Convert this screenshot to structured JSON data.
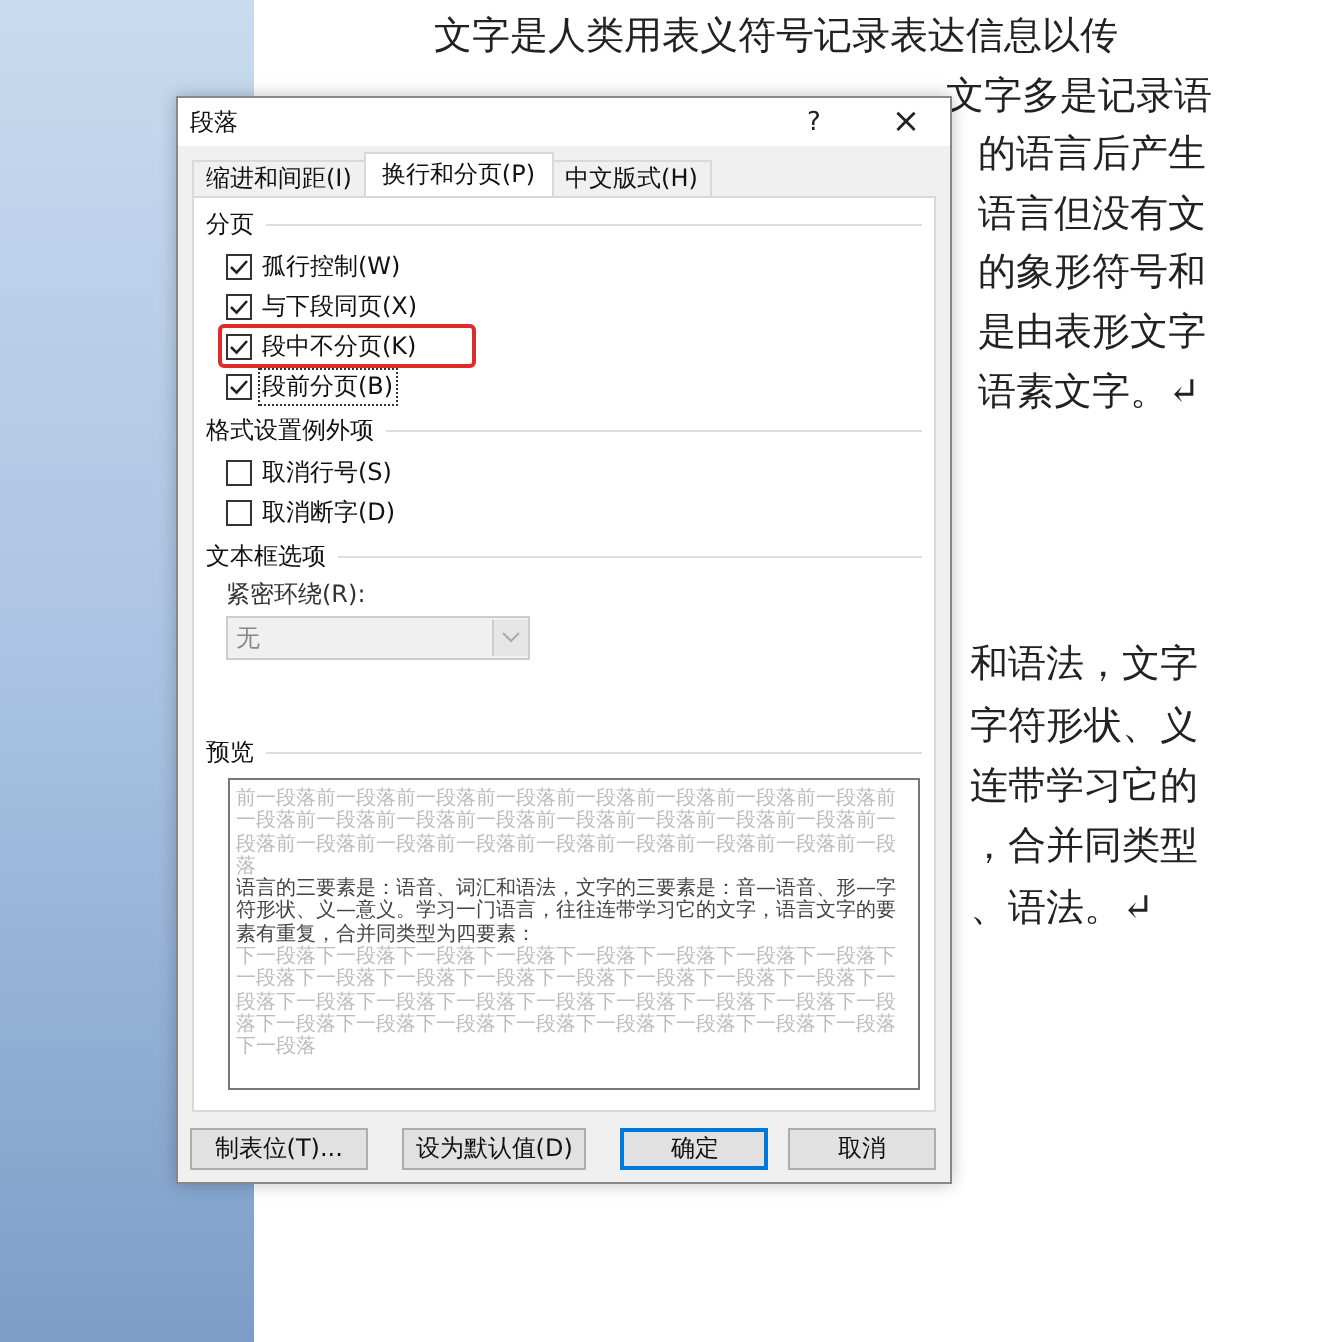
{
  "document": {
    "paragraph_1": [
      {
        "text": "文字是人类用表义符号记录表达信息以传",
        "kind": "full"
      },
      {
        "text": "文字多是记录语",
        "kind": "top"
      },
      {
        "text": "的语言后产生",
        "kind": "cut"
      },
      {
        "text": "语言但没有文",
        "kind": "cut"
      },
      {
        "text": "的象形符号和",
        "kind": "cut"
      },
      {
        "text": "是由表形文字",
        "kind": "cut"
      },
      {
        "text": "语素文字。↵",
        "kind": "cut"
      }
    ],
    "paragraph_2": [
      {
        "text": "和语法，文字",
        "kind": "cut"
      },
      {
        "text": "字符形状、义",
        "kind": "cut"
      },
      {
        "text": "连带学习它的",
        "kind": "cut"
      },
      {
        "text": "，合并同类型",
        "kind": "cut"
      },
      {
        "text": "、语法。↵",
        "kind": "cut"
      }
    ]
  },
  "dialog": {
    "title": "段落",
    "help": "?",
    "close": "×",
    "tabs": [
      {
        "label": "缩进和间距(I)",
        "selected": false
      },
      {
        "label": "换行和分页(P)",
        "selected": true
      },
      {
        "label": "中文版式(H)",
        "selected": false
      }
    ],
    "groups": [
      {
        "title": "分页",
        "items": [
          {
            "label": "孤行控制(W)",
            "checked": true,
            "highlighted": false,
            "focused": false
          },
          {
            "label": "与下段同页(X)",
            "checked": true,
            "highlighted": false,
            "focused": false
          },
          {
            "label": "段中不分页(K)",
            "checked": true,
            "highlighted": true,
            "focused": false
          },
          {
            "label": "段前分页(B)",
            "checked": true,
            "highlighted": false,
            "focused": true
          }
        ]
      },
      {
        "title": "格式设置例外项",
        "items": [
          {
            "label": "取消行号(S)",
            "checked": false,
            "highlighted": false,
            "focused": false
          },
          {
            "label": "取消断字(D)",
            "checked": false,
            "highlighted": false,
            "focused": false
          }
        ]
      }
    ],
    "textbox": {
      "title": "文本框选项",
      "label": "紧密环绕(R):",
      "value": "无",
      "disabled": true
    },
    "preview": {
      "title": "预览",
      "previous_paragraph": "前一段落前一段落前一段落前一段落前一段落前一段落前一段落前一段落前一段落前一段落前一段落前一段落前一段落前一段落前一段落前一段落前一段落前一段落前一段落前一段落前一段落前一段落前一段落前一段落前一段落",
      "sample": "语言的三要素是：语音、词汇和语法，文字的三要素是：音—语音、形—字符形状、义—意义。学习一门语言，往往连带学习它的文字，语言文字的要素有重复，合并同类型为四要素：",
      "next_paragraph": "下一段落下一段落下一段落下一段落下一段落下一段落下一段落下一段落下一段落下一段落下一段落下一段落下一段落下一段落下一段落下一段落下一段落下一段落下一段落下一段落下一段落下一段落下一段落下一段落下一段落下一段落下一段落下一段落下一段落下一段落下一段落下一段落下一段落下一段落"
    },
    "buttons": [
      {
        "label": "制表位(T)...",
        "default": false
      },
      {
        "label": "设为默认值(D)",
        "default": false
      },
      {
        "label": "确定",
        "default": true
      },
      {
        "label": "取消",
        "default": false
      }
    ]
  }
}
